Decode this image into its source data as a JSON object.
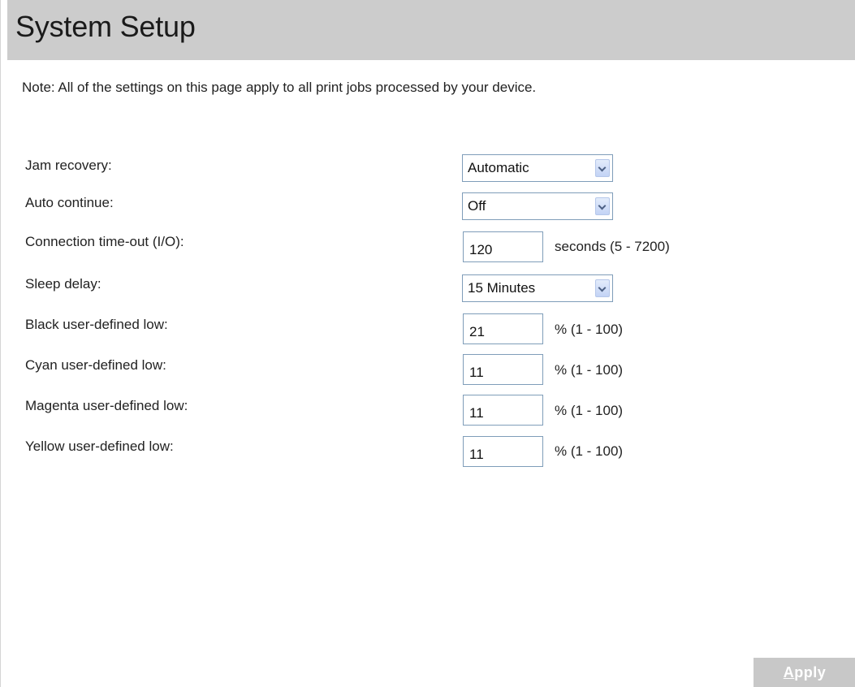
{
  "page": {
    "title": "System Setup",
    "note": "Note:  All of the settings on this page apply to all print jobs processed by your device."
  },
  "settings": {
    "jam_recovery": {
      "label": "Jam recovery:",
      "value": "Automatic"
    },
    "auto_continue": {
      "label": "Auto continue:",
      "value": "Off"
    },
    "connection_timeout": {
      "label": "Connection time-out (I/O):",
      "value": "120",
      "unit": "seconds (5 - 7200)"
    },
    "sleep_delay": {
      "label": "Sleep delay:",
      "value": "15 Minutes"
    },
    "black_low": {
      "label": "Black user-defined low:",
      "value": "21",
      "unit": "% (1 - 100)"
    },
    "cyan_low": {
      "label": "Cyan user-defined low:",
      "value": "11",
      "unit": "% (1 - 100)"
    },
    "magenta_low": {
      "label": "Magenta user-defined low:",
      "value": "11",
      "unit": "% (1 - 100)"
    },
    "yellow_low": {
      "label": "Yellow user-defined low:",
      "value": "11",
      "unit": "% (1 - 100)"
    }
  },
  "actions": {
    "apply_accel": "A",
    "apply_rest": "pply"
  },
  "colors": {
    "header_bg": "#cccccc",
    "input_border": "#7f9db9",
    "apply_bg": "#c8c8c8"
  },
  "icons": {
    "dropdown": "chevron-down-icon"
  }
}
